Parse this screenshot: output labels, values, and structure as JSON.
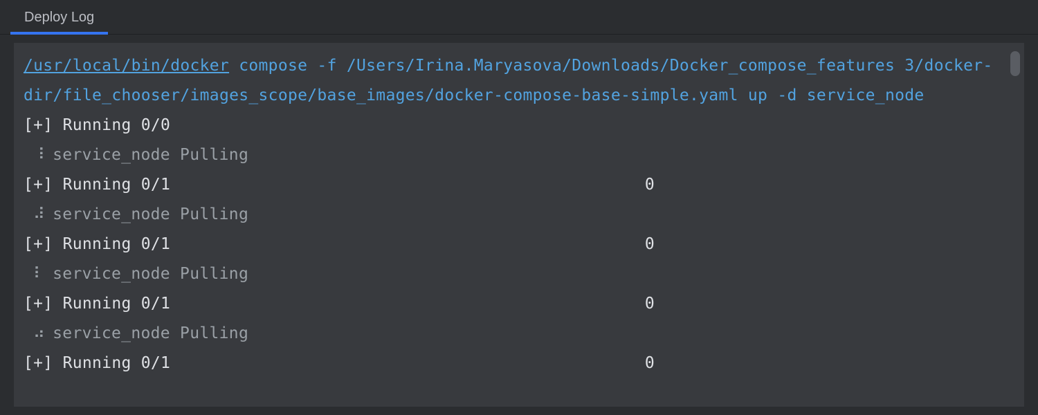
{
  "tab": {
    "label": "Deploy Log"
  },
  "command": {
    "path": "/usr/local/bin/docker",
    "args": " compose -f /Users/Irina.Maryasova/Downloads/Docker_compose_features 3/docker-dir/file_chooser/images_scope/base_images/docker-compose-base-simple.yaml up -d service_node"
  },
  "lines": [
    {
      "type": "running",
      "text": "[+] Running 0/0",
      "right": ""
    },
    {
      "type": "pulling",
      "spinner": "⠸",
      "text": " service_node Pulling"
    },
    {
      "type": "running",
      "text": "[+] Running 0/1",
      "right": "0"
    },
    {
      "type": "pulling",
      "spinner": "⠼",
      "text": " service_node Pulling"
    },
    {
      "type": "running",
      "text": "[+] Running 0/1",
      "right": "0"
    },
    {
      "type": "pulling",
      "spinner": "⠇",
      "text": " service_node Pulling"
    },
    {
      "type": "running",
      "text": "[+] Running 0/1",
      "right": "0"
    },
    {
      "type": "pulling",
      "spinner": "⠴",
      "text": " service_node Pulling"
    },
    {
      "type": "running",
      "text": "[+] Running 0/1",
      "right": "0"
    }
  ]
}
